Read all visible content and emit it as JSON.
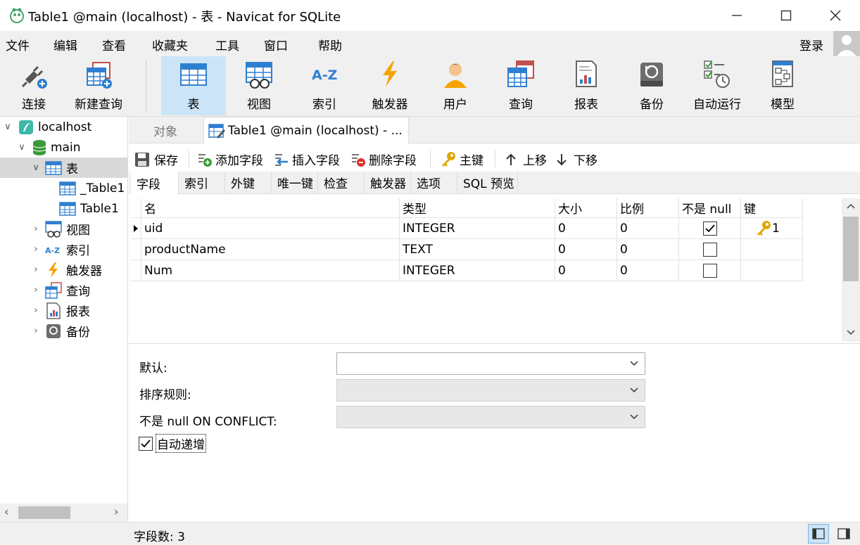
{
  "window": {
    "title": "Table1 @main (localhost) - 表 - Navicat for SQLite"
  },
  "menu": [
    "文件",
    "编辑",
    "查看",
    "收藏夹",
    "工具",
    "窗口",
    "帮助"
  ],
  "login_label": "登录",
  "toolbar": [
    "连接",
    "新建查询",
    "表",
    "视图",
    "索引",
    "触发器",
    "用户",
    "查询",
    "报表",
    "备份",
    "自动运行",
    "模型"
  ],
  "tree": {
    "connection": "localhost",
    "database": "main",
    "tables_label": "表",
    "tables": [
      "_Table1",
      "Table1"
    ],
    "others": [
      "视图",
      "索引",
      "触发器",
      "查询",
      "报表",
      "备份"
    ]
  },
  "tabs": {
    "objects": "对象",
    "active": "Table1 @main (localhost) - ..."
  },
  "subtoolbar": {
    "save": "保存",
    "add_field": "添加字段",
    "insert_field": "插入字段",
    "delete_field": "删除字段",
    "primary_key": "主键",
    "move_up": "上移",
    "move_down": "下移"
  },
  "field_tabs": [
    "字段",
    "索引",
    "外键",
    "唯一键",
    "检查",
    "触发器",
    "选项",
    "SQL 预览"
  ],
  "grid": {
    "headers": [
      "名",
      "类型",
      "大小",
      "比例",
      "不是 null",
      "键"
    ],
    "rows": [
      {
        "name": "uid",
        "type": "INTEGER",
        "size": "0",
        "scale": "0",
        "not_null": true,
        "key": "1"
      },
      {
        "name": "productName",
        "type": "TEXT",
        "size": "0",
        "scale": "0",
        "not_null": false,
        "key": ""
      },
      {
        "name": "Num",
        "type": "INTEGER",
        "size": "0",
        "scale": "0",
        "not_null": false,
        "key": ""
      }
    ]
  },
  "props": {
    "default_label": "默认:",
    "collation_label": "排序规则:",
    "conflict_label": "不是 null ON CONFLICT:",
    "autoinc_label": "自动递增",
    "autoinc_checked": true
  },
  "status": {
    "field_count": "字段数: 3"
  }
}
